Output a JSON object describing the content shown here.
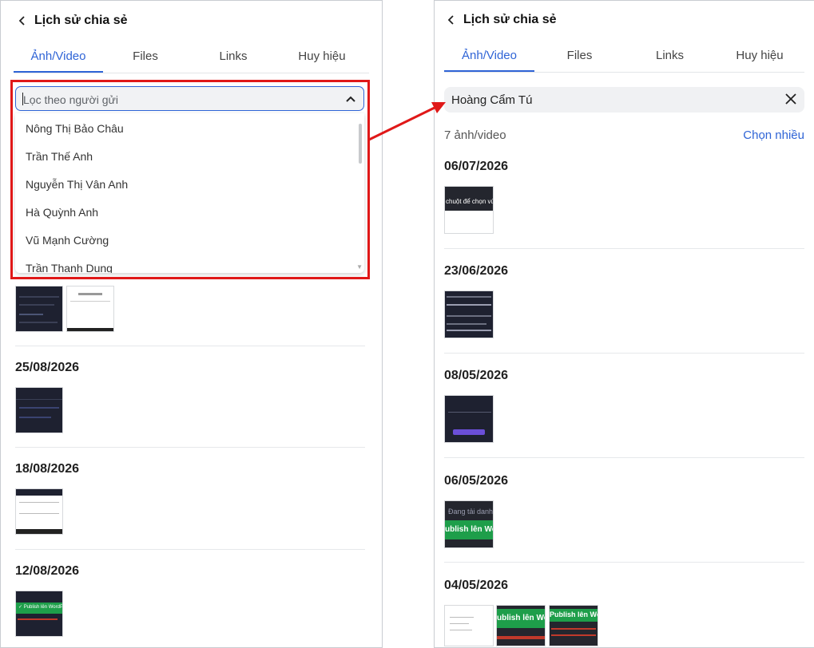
{
  "left": {
    "title": "Lịch sử chia sẻ",
    "tabs": [
      "Ảnh/Video",
      "Files",
      "Links",
      "Huy hiệu"
    ],
    "filter": {
      "placeholder": "Lọc theo người gửi"
    },
    "dropdown_options": [
      "Nông Thị Bảo Châu",
      "Trần Thế Anh",
      "Nguyễn Thị Vân Anh",
      "Hà Quỳnh Anh",
      "Vũ Mạnh Cường",
      "Trần Thanh Dung"
    ],
    "sections": [
      {
        "date": "25/08/2026"
      },
      {
        "date": "18/08/2026"
      },
      {
        "date": "12/08/2026",
        "thumb_text": "✓ Publish lên WordPress"
      }
    ]
  },
  "right": {
    "title": "Lịch sử chia sẻ",
    "tabs": [
      "Ảnh/Video",
      "Files",
      "Links",
      "Huy hiệu"
    ],
    "selected_sender": "Hoàng Cẩm Tú",
    "count_label": "7 ảnh/video",
    "select_multiple_label": "Chọn nhiều",
    "sections": [
      {
        "date": "06/07/2026",
        "thumb_text": "chuột để chọn vù"
      },
      {
        "date": "23/06/2026"
      },
      {
        "date": "08/05/2026"
      },
      {
        "date": "06/05/2026",
        "thumb_text_1": "Đang tải danh m",
        "thumb_text_2": "ublish lên WordP"
      },
      {
        "date": "04/05/2026",
        "thumb_text_1": "ublish lên WordP",
        "thumb_text_2": "Publish lên WordP"
      }
    ]
  },
  "colors": {
    "accent": "#2f64d6",
    "highlight": "#e01818",
    "publish_green": "#1e9e4a",
    "thumb_dark": "#1e2130"
  }
}
